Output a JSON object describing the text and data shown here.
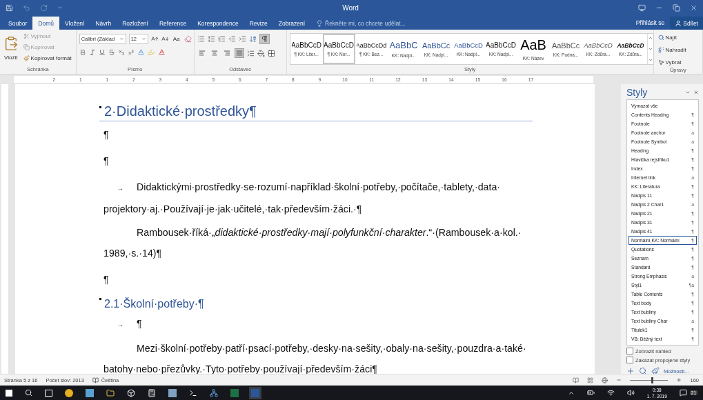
{
  "window": {
    "title": "Word"
  },
  "tabs": [
    {
      "label": "Soubor",
      "selected": false
    },
    {
      "label": "Domů",
      "selected": true
    },
    {
      "label": "Vložení",
      "selected": false
    },
    {
      "label": "Návrh",
      "selected": false
    },
    {
      "label": "Rozložení",
      "selected": false
    },
    {
      "label": "Reference",
      "selected": false
    },
    {
      "label": "Korespondence",
      "selected": false
    },
    {
      "label": "Revize",
      "selected": false
    },
    {
      "label": "Zobrazení",
      "selected": false
    }
  ],
  "tell_me": {
    "placeholder": "Řekněte mi, co chcete udělat..."
  },
  "sign_in": "Přihlásit se",
  "share": "Sdílet",
  "clipboard": {
    "paste": "Vložit",
    "cut": "Vyjmout",
    "copy": "Kopírovat",
    "format_painter": "Kopírovat formát",
    "label": "Schránka"
  },
  "font": {
    "name": "Calibri (Základ",
    "size": "12",
    "change_case": "Aa",
    "label": "Písmo"
  },
  "paragraph": {
    "show_marks": true,
    "alignment": [
      {
        "kind": "left",
        "selected": false
      },
      {
        "kind": "center",
        "selected": false
      },
      {
        "kind": "right",
        "selected": false
      },
      {
        "kind": "justify",
        "selected": true
      }
    ],
    "label": "Odstavec"
  },
  "styles_gallery": {
    "label": "Styly",
    "items": [
      {
        "preview": "AaBbCcD",
        "name": "¶ KK: Liter...",
        "kind": "normal",
        "selected": false
      },
      {
        "preview": "AaBbCcD",
        "name": "¶ KK: Nor...",
        "kind": "normal",
        "selected": true
      },
      {
        "preview": "AaBbCcDd",
        "name": "¶ KK: Bez...",
        "kind": "small",
        "selected": false
      },
      {
        "preview": "AaBbC",
        "name": "KK: Nadpi...",
        "kind": "heading1",
        "selected": false
      },
      {
        "preview": "AaBbCc",
        "name": "KK: Nadpi...",
        "kind": "heading2",
        "selected": false
      },
      {
        "preview": "AaBbCcD",
        "name": "KK: Nadpi...",
        "kind": "heading3",
        "selected": false
      },
      {
        "preview": "AaBbCcD",
        "name": "KK: Nadpi...",
        "kind": "normal",
        "selected": false
      },
      {
        "preview": "AaB",
        "name": "KK: Název",
        "kind": "title",
        "selected": false
      },
      {
        "preview": "AaBbCc",
        "name": "KK: Podna...",
        "kind": "subtitle",
        "selected": false
      },
      {
        "preview": "AaBbCcD",
        "name": "KK: Zdůra...",
        "kind": "emphasis",
        "selected": false
      },
      {
        "preview": "AaBbCcD",
        "name": "KK: Zdůra...",
        "kind": "strong",
        "selected": false
      }
    ]
  },
  "editing": {
    "find": "Najít",
    "replace": "Nahradit",
    "select": "Vybrat",
    "label": "Úpravy"
  },
  "ruler": [
    "2",
    "1",
    "1",
    "2",
    "3",
    "4",
    "5",
    "6",
    "7",
    "8",
    "9",
    "10",
    "11",
    "12",
    "13",
    "14",
    "15",
    "16",
    "17"
  ],
  "document": [
    {
      "kind": "heading1",
      "text": "2·Didaktické·prostředky¶"
    },
    {
      "kind": "mark",
      "text": "¶"
    },
    {
      "kind": "mark",
      "text": "¶"
    },
    {
      "kind": "tab",
      "tab": "→",
      "text": "Didaktickými·prostředky·se·rozumí·například·školní·potřeby,·počítače,·tablety,·data·projektory·aj.·Používají·je·jak·učitelé,·tak·především·žáci.·¶"
    },
    {
      "kind": "indent",
      "text": "Rambousek·říká·„*didaktické·prostředky·mají·polyfunkční·charakter*.“·(Rambousek·a·kol.·1989,·s.·14)¶"
    },
    {
      "kind": "mark",
      "text": "¶"
    },
    {
      "kind": "heading2",
      "text": "2.1·Školní·potřeby·¶"
    },
    {
      "kind": "tab",
      "tab": "→",
      "text": "¶"
    },
    {
      "kind": "indent",
      "text": "Mezi·školní·potřeby·patří·psací·potřeby,·desky·na·sešity,·obaly·na·sešity,·pouzdra·a·také·batohy·nebo·přezůvky.·Tyto·potřeby·používají·především·žáci¶"
    }
  ],
  "styles_pane": {
    "title": "Styly",
    "items": [
      {
        "name": "Vymazat vše",
        "selected": false
      },
      {
        "name": "Contents Heading",
        "mark": "¶",
        "selected": false
      },
      {
        "name": "Footnote",
        "mark": "¶",
        "selected": false
      },
      {
        "name": "Footnote anchor",
        "mark": "a",
        "selected": false
      },
      {
        "name": "Footnote Symbol",
        "mark": "a",
        "selected": false
      },
      {
        "name": "Heading",
        "mark": "¶",
        "selected": false
      },
      {
        "name": "Hlavička rejstříku1",
        "mark": "¶",
        "selected": false
      },
      {
        "name": "Index",
        "mark": "¶",
        "selected": false
      },
      {
        "name": "Internet link",
        "mark": "a",
        "selected": false
      },
      {
        "name": "KK: Literatura",
        "mark": "¶",
        "selected": false
      },
      {
        "name": "Nadpis 11",
        "mark": "¶",
        "selected": false
      },
      {
        "name": "Nadpis 2 Char1",
        "mark": "a",
        "selected": false
      },
      {
        "name": "Nadpis 21",
        "mark": "¶",
        "selected": false
      },
      {
        "name": "Nadpis 31",
        "mark": "¶",
        "selected": false
      },
      {
        "name": "Nadpis 41",
        "mark": "¶",
        "selected": false
      },
      {
        "name": "Normální,KK: Normální",
        "mark": "¶",
        "selected": true
      },
      {
        "name": "Quotations",
        "mark": "¶",
        "selected": false
      },
      {
        "name": "Seznam",
        "mark": "¶",
        "selected": false
      },
      {
        "name": "Standard",
        "mark": "¶",
        "selected": false
      },
      {
        "name": "Strong Emphasis",
        "mark": "a",
        "selected": false
      },
      {
        "name": "Styl1",
        "mark": "¶a",
        "selected": false
      },
      {
        "name": "Table Contents",
        "mark": "¶",
        "selected": false
      },
      {
        "name": "Text body",
        "mark": "¶",
        "selected": false
      },
      {
        "name": "Text bubliny",
        "mark": "¶",
        "selected": false
      },
      {
        "name": "Text bubliny Char",
        "mark": "a",
        "selected": false
      },
      {
        "name": "Titulek1",
        "mark": "¶",
        "selected": false
      },
      {
        "name": "VB: Běžný text",
        "mark": "¶",
        "selected": false
      }
    ],
    "options": [
      {
        "label": "Zobrazit náhled",
        "checked": false
      },
      {
        "label": "Zakázat propojené styly",
        "checked": false
      }
    ],
    "link": "Možnosti..."
  },
  "status_bar": {
    "page": "Stránka 5 z 16",
    "words": "Počet slov: 2013",
    "language": "Čeština",
    "zoom": {
      "level": 0.55,
      "reading": "160"
    }
  },
  "taskbar": {
    "time": "0:38",
    "date": "1. 7. 2019",
    "badge": "21"
  }
}
